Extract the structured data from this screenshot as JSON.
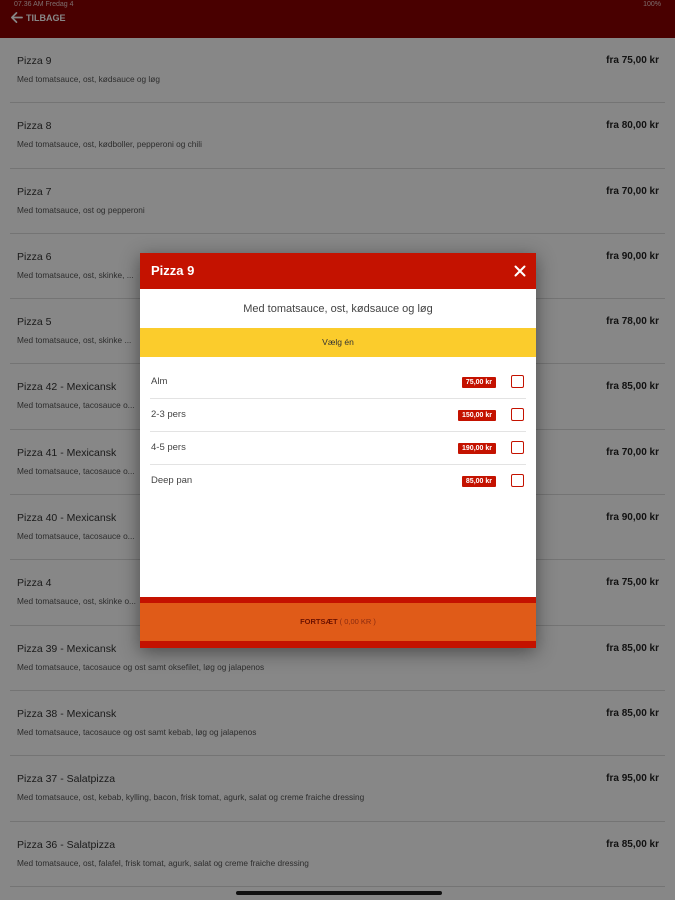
{
  "status_bar": {
    "time": "07.36 AM   Fredag 4",
    "right": "100%"
  },
  "header": {
    "back_label": "TILBAGE"
  },
  "menu": [
    {
      "name": "Pizza 9",
      "desc": "Med tomatsauce, ost, kødsauce og løg",
      "price": "fra 75,00 kr"
    },
    {
      "name": "Pizza 8",
      "desc": "Med tomatsauce, ost, kødboller, pepperoni og chili",
      "price": "fra 80,00 kr"
    },
    {
      "name": "Pizza 7",
      "desc": "Med tomatsauce, ost og pepperoni",
      "price": "fra 70,00 kr"
    },
    {
      "name": "Pizza 6",
      "desc": "Med tomatsauce, ost, skinke, ...",
      "price": "fra 90,00 kr"
    },
    {
      "name": "Pizza 5",
      "desc": "Med tomatsauce, ost, skinke ...",
      "price": "fra 78,00 kr"
    },
    {
      "name": "Pizza 42 - Mexicansk",
      "desc": "Med tomatsauce, tacosauce o...",
      "price": "fra 85,00 kr"
    },
    {
      "name": "Pizza 41 - Mexicansk",
      "desc": "Med tomatsauce, tacosauce o...",
      "price": "fra 70,00 kr"
    },
    {
      "name": "Pizza 40 - Mexicansk",
      "desc": "Med tomatsauce, tacosauce o...",
      "price": "fra 90,00 kr"
    },
    {
      "name": "Pizza 4",
      "desc": "Med tomatsauce, ost, skinke o...",
      "price": "fra 75,00 kr"
    },
    {
      "name": "Pizza 39 - Mexicansk",
      "desc": "Med tomatsauce, tacosauce og ost samt oksefilet, løg og jalapenos",
      "price": "fra 85,00 kr"
    },
    {
      "name": "Pizza 38 - Mexicansk",
      "desc": "Med tomatsauce, tacosauce og ost samt kebab, løg og jalapenos",
      "price": "fra 85,00 kr"
    },
    {
      "name": "Pizza 37 - Salatpizza",
      "desc": "Med tomatsauce, ost, kebab, kylling, bacon, frisk tomat, agurk, salat og creme fraiche dressing",
      "price": "fra 95,00 kr"
    },
    {
      "name": "Pizza 36 - Salatpizza",
      "desc": "Med tomatsauce, ost, falafel, frisk tomat, agurk, salat og creme fraiche dressing",
      "price": "fra 85,00 kr"
    }
  ],
  "modal": {
    "title": "Pizza 9",
    "description": "Med tomatsauce, ost, kødsauce og løg",
    "choose_label": "Vælg én",
    "options": [
      {
        "name": "Alm",
        "price": "75,00 kr",
        "checked": false
      },
      {
        "name": "2-3 pers",
        "price": "150,00 kr",
        "checked": false
      },
      {
        "name": "4-5 pers",
        "price": "190,00 kr",
        "checked": false
      },
      {
        "name": "Deep pan",
        "price": "85,00 kr",
        "checked": false
      }
    ],
    "continue_label": "FORTSÆT",
    "continue_amount": "( 0,00 KR )"
  },
  "colors": {
    "header_bg": "#8b0000",
    "modal_header_bg": "#c41200",
    "choose_bg": "#fbcc2c",
    "continue_bg": "#e05b18"
  }
}
